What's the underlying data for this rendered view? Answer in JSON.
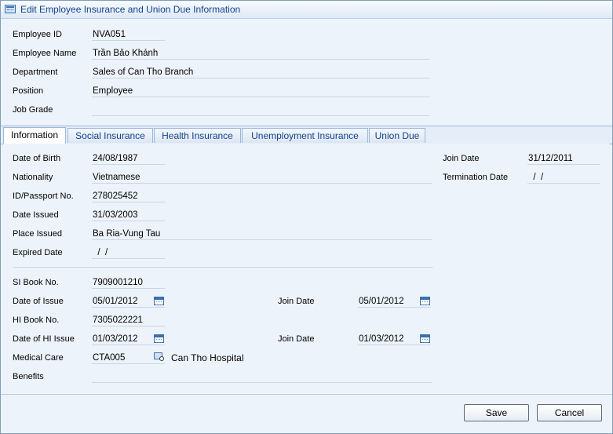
{
  "window": {
    "title": "Edit Employee Insurance and Union Due Information"
  },
  "employee": {
    "id_label": "Employee ID",
    "id_value": "NVA051",
    "name_label": "Employee Name",
    "name_value": "Trần Bảo Khánh",
    "dept_label": "Department",
    "dept_value": "Sales of Can Tho Branch",
    "position_label": "Position",
    "position_value": "Employee",
    "grade_label": "Job Grade",
    "grade_value": ""
  },
  "tabs": [
    {
      "label": "Information",
      "active": true
    },
    {
      "label": "Social Insurance",
      "active": false
    },
    {
      "label": "Health Insurance",
      "active": false
    },
    {
      "label": "Unemployment Insurance",
      "active": false
    },
    {
      "label": "Union Due",
      "active": false
    }
  ],
  "info": {
    "dob_label": "Date of Birth",
    "dob_value": "24/08/1987",
    "nationality_label": "Nationality",
    "nationality_value": "Vietnamese",
    "idpass_label": "ID/Passport No.",
    "idpass_value": "278025452",
    "issued_label": "Date Issued",
    "issued_value": "31/03/2003",
    "place_label": "Place Issued",
    "place_value": "Ba Ria-Vung Tau",
    "expired_label": "Expired Date",
    "expired_value": "  /  /",
    "joindate_label": "Join Date",
    "joindate_value": "31/12/2011",
    "termination_label": "Termination Date",
    "termination_value": "  /  /"
  },
  "insurance": {
    "si_label": "SI Book No.",
    "si_value": "7909001210",
    "si_issue_label": "Date of Issue",
    "si_issue_value": "05/01/2012",
    "si_join_label": "Join Date",
    "si_join_value": "05/01/2012",
    "hi_label": "HI Book No.",
    "hi_value": "7305022221",
    "hi_issue_label": "Date of HI Issue",
    "hi_issue_value": "01/03/2012",
    "hi_join_label": "Join Date",
    "hi_join_value": "01/03/2012",
    "medical_label": "Medical Care",
    "medical_code": "CTA005",
    "medical_name": "Can Tho Hospital",
    "benefits_label": "Benefits",
    "benefits_value": ""
  },
  "buttons": {
    "save": "Save",
    "cancel": "Cancel"
  },
  "colors": {
    "title_text": "#15428b",
    "border": "#7f9db9",
    "panel": "#edf3fb"
  }
}
